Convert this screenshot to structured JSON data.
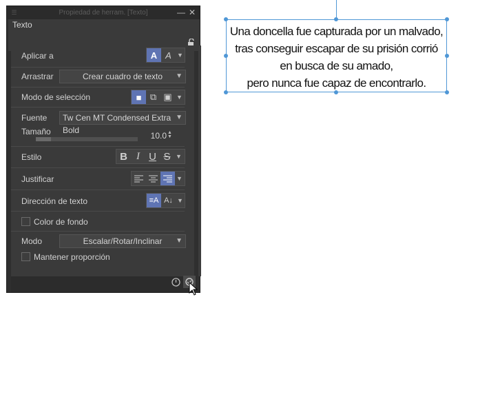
{
  "panel": {
    "title": "Propiedad de herram. [Texto]",
    "minimize_symbol": "—",
    "close_symbol": "✕",
    "tab_label": "Texto",
    "lock_icon": "lock-icon",
    "rows": {
      "apply_to": {
        "label": "Aplicar a",
        "icons": [
          "text-fill-icon",
          "text-outline-icon"
        ]
      },
      "drag": {
        "label": "Arrastrar",
        "value": "Crear cuadro de texto"
      },
      "selection_mode": {
        "label": "Modo de selección",
        "icons": [
          "new-selection-icon",
          "add-selection-icon",
          "intersect-selection-icon"
        ]
      },
      "font": {
        "label": "Fuente",
        "value": "Tw Cen MT Condensed Extra Bold"
      },
      "size": {
        "label": "Tamaño",
        "value": "10.0",
        "slider_fraction": 0.15
      },
      "style": {
        "label": "Estilo",
        "bold": "B",
        "italic": "I",
        "underline": "U",
        "strike": "S"
      },
      "justify": {
        "label": "Justificar",
        "icons": [
          "align-left-icon",
          "align-center-icon",
          "align-right-icon"
        ],
        "active": "align-right"
      },
      "direction": {
        "label": "Dirección de texto",
        "icons": [
          "horizontal-text-icon",
          "vertical-text-icon"
        ]
      },
      "background": {
        "label": "Color de fondo",
        "checked": false
      },
      "mode": {
        "label": "Modo",
        "value": "Escalar/Rotar/Inclinar"
      },
      "keep_ratio": {
        "label": "Mantener proporción",
        "checked": false
      }
    },
    "footer_icons": [
      "reset-icon",
      "settings-icon"
    ]
  },
  "canvas": {
    "text_lines": [
      "Una doncella fue capturada por un malvado,",
      "tras conseguir escapar de su prisión corrió",
      "en busca de su amado,",
      "pero nunca fue capaz de encontrarlo."
    ]
  },
  "colors": {
    "accent": "#5f74b3",
    "selection": "#4f97d6",
    "panel_bg": "#3a3a3a"
  }
}
